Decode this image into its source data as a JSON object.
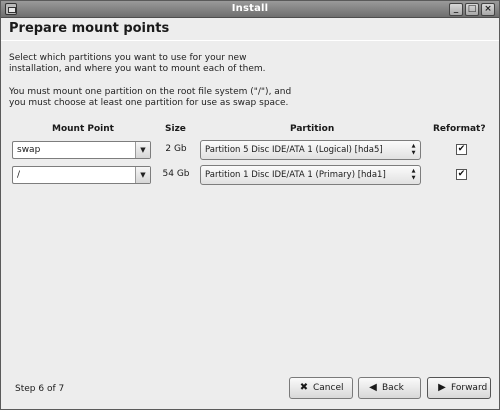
{
  "window": {
    "title": "Install"
  },
  "header": {
    "title": "Prepare mount points"
  },
  "intro": {
    "line1": "Select which partitions you want to use for your new",
    "line2": "installation, and where you want to mount each of them.",
    "line3": "You must mount one partition on the root file system (\"/\"), and",
    "line4": "you must choose at least one partition for use as swap space."
  },
  "table": {
    "headers": {
      "mount_point": "Mount Point",
      "size": "Size",
      "partition": "Partition",
      "reformat": "Reformat?"
    },
    "rows": [
      {
        "mount_point": "swap",
        "size": "2 Gb",
        "partition": "Partition 5 Disc IDE/ATA 1 (Logical) [hda5]",
        "reformat": true,
        "check_glyph": "✔"
      },
      {
        "mount_point": "/",
        "size": "54 Gb",
        "partition": "Partition 1 Disc IDE/ATA 1 (Primary) [hda1]",
        "reformat": true,
        "check_glyph": "✔"
      }
    ]
  },
  "footer": {
    "step": "Step 6 of 7",
    "cancel_label": "Cancel",
    "back_label": "Back",
    "forward_label": "Forward"
  },
  "icons": {
    "window_controls": [
      "minimize-icon",
      "maximize-icon",
      "close-icon"
    ],
    "cancel": "cancel-icon",
    "back": "back-arrow-icon",
    "forward": "forward-arrow-icon"
  }
}
